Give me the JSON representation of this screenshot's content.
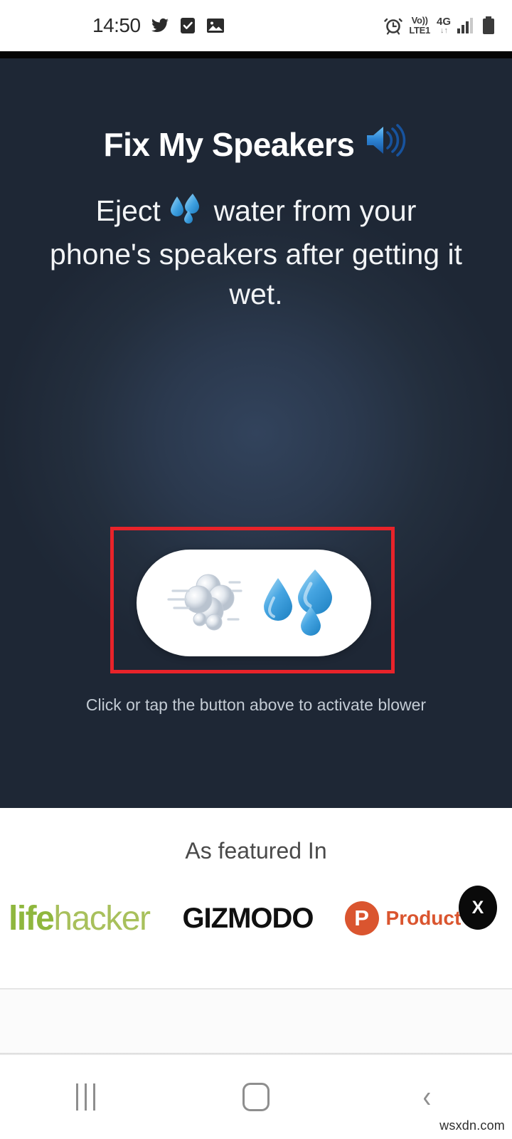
{
  "statusbar": {
    "time": "14:50",
    "icons_left": [
      "twitter-icon",
      "checkbox-icon",
      "photo-icon"
    ],
    "volte_top": "Vo))",
    "volte_bottom": "LTE1",
    "network": "4G",
    "data_arrows": "↓↑",
    "icons_right": [
      "alarm-icon",
      "volte-icon",
      "network-4g-icon",
      "signal-bars-icon",
      "battery-icon"
    ]
  },
  "hero": {
    "title": "Fix My Speakers",
    "title_icon": "speaker-loud-icon",
    "subtitle_part1": "Eject",
    "subtitle_emoji": "sweat-droplets-icon",
    "subtitle_part2": "water from your phone's speakers after getting it wet.",
    "button_icons": [
      "dashing-away-icon",
      "sweat-droplets-icon"
    ],
    "hint": "Click or tap the button above to activate blower",
    "highlight_color": "#e8232a",
    "bg_color": "#232e3d"
  },
  "featured": {
    "title": "As featured In",
    "logos": [
      {
        "name": "lifehacker",
        "text_bold": "life",
        "text_light": "hacker",
        "color": "#8fb73e"
      },
      {
        "name": "gizmodo",
        "text": "GIZMODO",
        "color": "#101010"
      },
      {
        "name": "product-hunt",
        "mark": "P",
        "text": "Product H",
        "color": "#da552f"
      }
    ]
  },
  "close_button": {
    "label": "X"
  },
  "navbar": {
    "recents_label": "recents-icon",
    "home_label": "home-icon",
    "back_label": "back-icon",
    "back_glyph": "‹"
  },
  "watermark": {
    "text": "wsxdn.com"
  }
}
